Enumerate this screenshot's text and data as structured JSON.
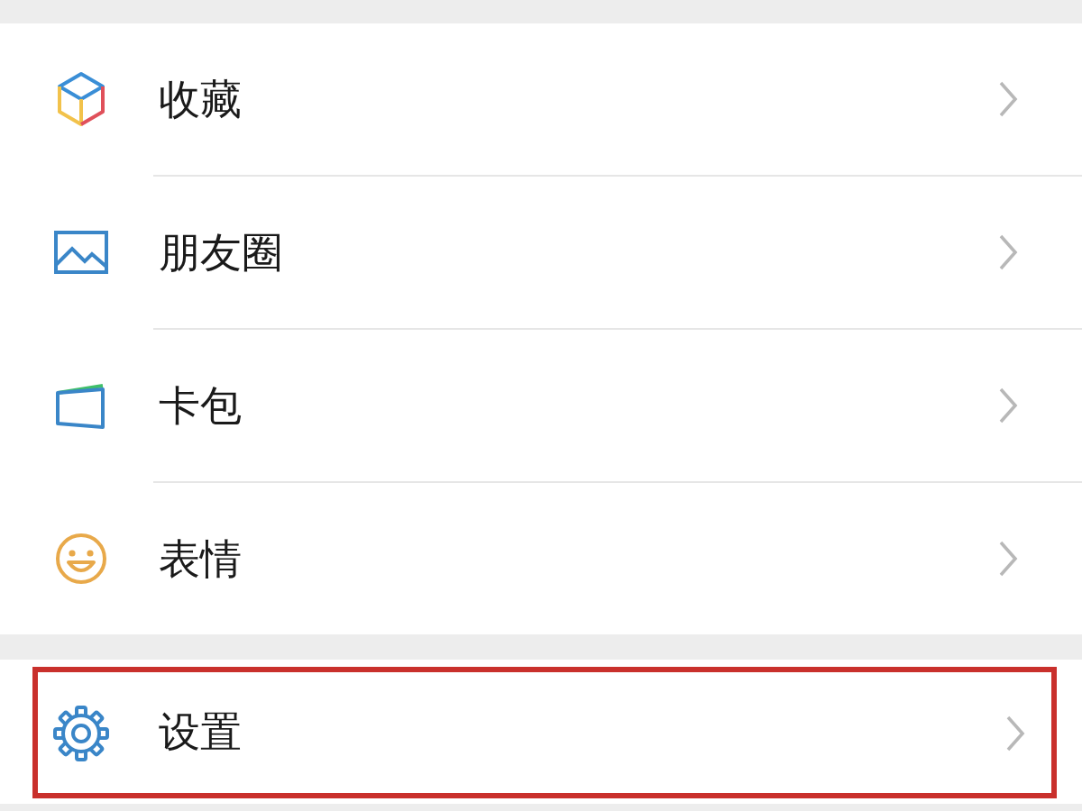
{
  "groups": [
    {
      "items": [
        {
          "kind": "cube",
          "label": "收藏",
          "highlighted": false
        },
        {
          "kind": "picture",
          "label": "朋友圈",
          "highlighted": false
        },
        {
          "kind": "card",
          "label": "卡包",
          "highlighted": false
        },
        {
          "kind": "smile",
          "label": "表情",
          "highlighted": false
        }
      ]
    },
    {
      "items": [
        {
          "kind": "gear",
          "label": "设置",
          "highlighted": true
        }
      ]
    }
  ]
}
